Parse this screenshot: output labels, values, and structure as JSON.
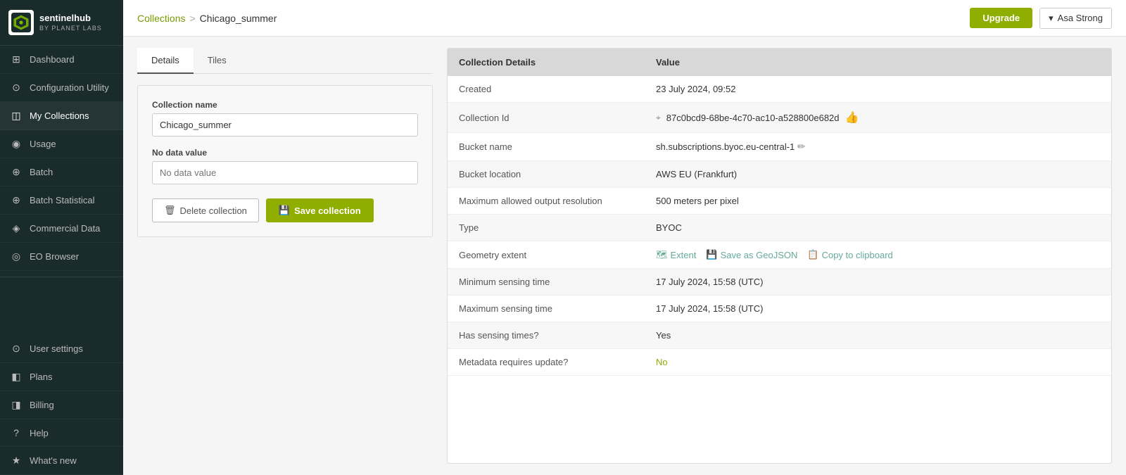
{
  "sidebar": {
    "logo": {
      "brand": "sentinelhub",
      "sub": "by PLANET LABS"
    },
    "items": [
      {
        "id": "dashboard",
        "label": "Dashboard",
        "icon": "⊞"
      },
      {
        "id": "configuration-utility",
        "label": "Configuration Utility",
        "icon": "⊙"
      },
      {
        "id": "my-collections",
        "label": "My Collections",
        "icon": "◫",
        "active": true
      },
      {
        "id": "usage",
        "label": "Usage",
        "icon": "◉"
      },
      {
        "id": "batch",
        "label": "Batch",
        "icon": "⊕"
      },
      {
        "id": "batch-statistical",
        "label": "Batch Statistical",
        "icon": "⊕"
      },
      {
        "id": "commercial-data",
        "label": "Commercial Data",
        "icon": "◈"
      },
      {
        "id": "eo-browser",
        "label": "EO Browser",
        "icon": "◎"
      }
    ],
    "bottom_items": [
      {
        "id": "user-settings",
        "label": "User settings",
        "icon": "⊙"
      },
      {
        "id": "plans",
        "label": "Plans",
        "icon": "◧"
      },
      {
        "id": "billing",
        "label": "Billing",
        "icon": "◨"
      },
      {
        "id": "help",
        "label": "Help",
        "icon": "?"
      },
      {
        "id": "whats-new",
        "label": "What's new",
        "icon": "★"
      }
    ]
  },
  "header": {
    "breadcrumb_link": "Collections",
    "breadcrumb_sep": ">",
    "breadcrumb_current": "Chicago_summer",
    "upgrade_label": "Upgrade",
    "user_dropdown_arrow": "▾",
    "user_name": "Asa Strong"
  },
  "tabs": [
    {
      "id": "details",
      "label": "Details",
      "active": true
    },
    {
      "id": "tiles",
      "label": "Tiles",
      "active": false
    }
  ],
  "form": {
    "collection_name_label": "Collection name",
    "collection_name_value": "Chicago_summer",
    "no_data_value_label": "No data value",
    "no_data_value_placeholder": "No data value",
    "delete_btn_label": "Delete collection",
    "save_btn_label": "Save collection"
  },
  "collection_details": {
    "header_col1": "Collection Details",
    "header_col2": "Value",
    "rows": [
      {
        "label": "Created",
        "value": "23 July 2024, 09:52",
        "type": "text"
      },
      {
        "label": "Collection Id",
        "value": "87c0bcd9-68be-4c70-ac10-a528800e682d",
        "type": "id"
      },
      {
        "label": "Bucket name",
        "value": "sh.subscriptions.byoc.eu-central-1",
        "type": "editable"
      },
      {
        "label": "Bucket location",
        "value": "AWS EU (Frankfurt)",
        "type": "text"
      },
      {
        "label": "Maximum allowed output resolution",
        "value": "500 meters per pixel",
        "type": "text"
      },
      {
        "label": "Type",
        "value": "BYOC",
        "type": "text"
      },
      {
        "label": "Geometry extent",
        "value": "",
        "type": "geometry"
      },
      {
        "label": "Minimum sensing time",
        "value": "17 July 2024, 15:58 (UTC)",
        "type": "text"
      },
      {
        "label": "Maximum sensing time",
        "value": "17 July 2024, 15:58 (UTC)",
        "type": "text"
      },
      {
        "label": "Has sensing times?",
        "value": "Yes",
        "type": "text"
      },
      {
        "label": "Metadata requires update?",
        "value": "No",
        "type": "meta-no"
      }
    ],
    "geometry_links": [
      {
        "id": "extent",
        "icon": "🗺",
        "label": "Extent"
      },
      {
        "id": "save-geojson",
        "icon": "💾",
        "label": "Save as GeoJSON"
      },
      {
        "id": "copy-clipboard",
        "icon": "📋",
        "label": "Copy to clipboard"
      }
    ]
  }
}
